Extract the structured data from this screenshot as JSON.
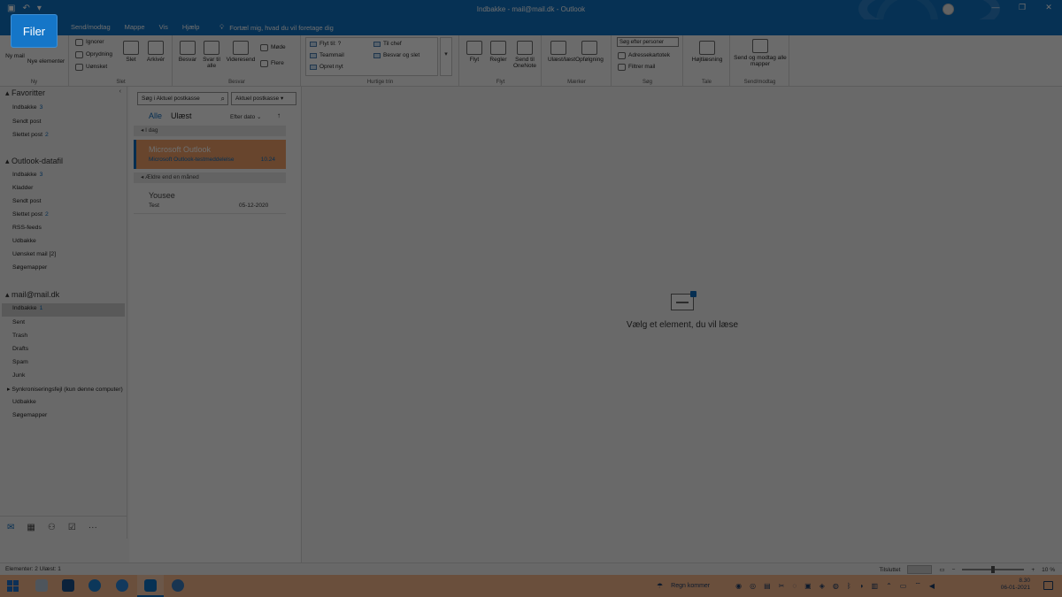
{
  "window": {
    "title": "Indbakke - mail@mail.dk  -  Outlook",
    "controls": [
      "—",
      "❐",
      "✕"
    ]
  },
  "filer": {
    "label": "Filer"
  },
  "menu": {
    "tabs": [
      "Send/modtag",
      "Mappe",
      "Vis",
      "Hjælp"
    ],
    "tell_me": "Fortæl mig, hvad du vil foretage dig"
  },
  "ribbon": {
    "new": {
      "new_mail": "Ny mail",
      "new_items": "Nye elementer",
      "label": "Ny"
    },
    "delete": {
      "ignore": "Ignorer",
      "cleanup": "Oprydning",
      "junk": "Uønsket",
      "delete": "Slet",
      "archive": "Arkivér",
      "label": "Slet"
    },
    "respond": {
      "reply": "Besvar",
      "reply_all": "Svar til alle",
      "forward": "Videresend",
      "meeting": "Møde",
      "more": "Flere",
      "label": "Besvar"
    },
    "quicksteps": {
      "items": [
        "Flyt til: ?",
        "Til chef",
        "Teammail",
        "Besvar og slet",
        "Opret nyt"
      ],
      "label": "Hurtige trin"
    },
    "move": {
      "move": "Flyt",
      "rules": "Regler",
      "onenote": "Send til OneNote",
      "label": "Flyt"
    },
    "tags": {
      "unread": "Ulæst/læst",
      "followup": "Opfølgning",
      "label": "Mærker"
    },
    "find": {
      "search_people": "Søg efter personer",
      "address_book": "Adressekartotek",
      "filter": "Filtrer mail",
      "label": "Søg"
    },
    "speech": {
      "read_aloud": "Højtlæsning",
      "label": "Tale"
    },
    "sendreceive": {
      "all": "Send og modtag alle mapper",
      "label": "Send/modtag"
    }
  },
  "nav": {
    "favorites": "Favoritter",
    "fav_items": [
      {
        "label": "Indbakke",
        "count": "3"
      },
      {
        "label": "Sendt post",
        "count": ""
      },
      {
        "label": "Slettet post",
        "count": "2"
      }
    ],
    "account1": "Outlook-datafil",
    "acc1_items": [
      {
        "label": "Indbakke",
        "count": "3"
      },
      {
        "label": "Kladder",
        "count": ""
      },
      {
        "label": "Sendt post",
        "count": ""
      },
      {
        "label": "Slettet post",
        "count": "2"
      },
      {
        "label": "RSS-feeds",
        "count": ""
      },
      {
        "label": "Udbakke",
        "count": ""
      },
      {
        "label": "Uønsket mail [2]",
        "count": ""
      },
      {
        "label": "Søgemapper",
        "count": ""
      }
    ],
    "account2": "mail@mail.dk",
    "acc2_items": [
      {
        "label": "Indbakke",
        "count": "1"
      },
      {
        "label": "Sent",
        "count": ""
      },
      {
        "label": "Trash",
        "count": ""
      },
      {
        "label": "Drafts",
        "count": ""
      },
      {
        "label": "Spam",
        "count": ""
      },
      {
        "label": "Junk",
        "count": ""
      },
      {
        "label": "Synkroniseringsfejl (kun denne computer)",
        "count": ""
      },
      {
        "label": "Udbakke",
        "count": ""
      },
      {
        "label": "Søgemapper",
        "count": ""
      }
    ]
  },
  "list": {
    "search_placeholder": "Søg i Aktuel postkasse",
    "scope": "Aktuel postkasse",
    "filter_all": "Alle",
    "filter_unread": "Ulæst",
    "sort": "Efter dato",
    "group_today": "I dag",
    "selected": {
      "from": "Microsoft Outlook",
      "subject": "Microsoft Outlook-testmeddelelse",
      "time": "10.24"
    },
    "group_older": "Ældre end en måned",
    "older": {
      "from": "Yousee",
      "subject": "Test",
      "date": "05-12-2020"
    }
  },
  "reading": {
    "empty_message": "Vælg et element, du vil læse"
  },
  "status": {
    "left": "Elementer: 2  Ulæst: 1",
    "right_label": "Tilsluttet",
    "zoom": "10 %"
  },
  "taskbar": {
    "weather": "Regn kommer",
    "time": "8.30",
    "date": "06-01-2021"
  },
  "colors": {
    "accent": "#0f72c4",
    "selection": "#f1a168",
    "taskbar": "#f6b78c"
  }
}
